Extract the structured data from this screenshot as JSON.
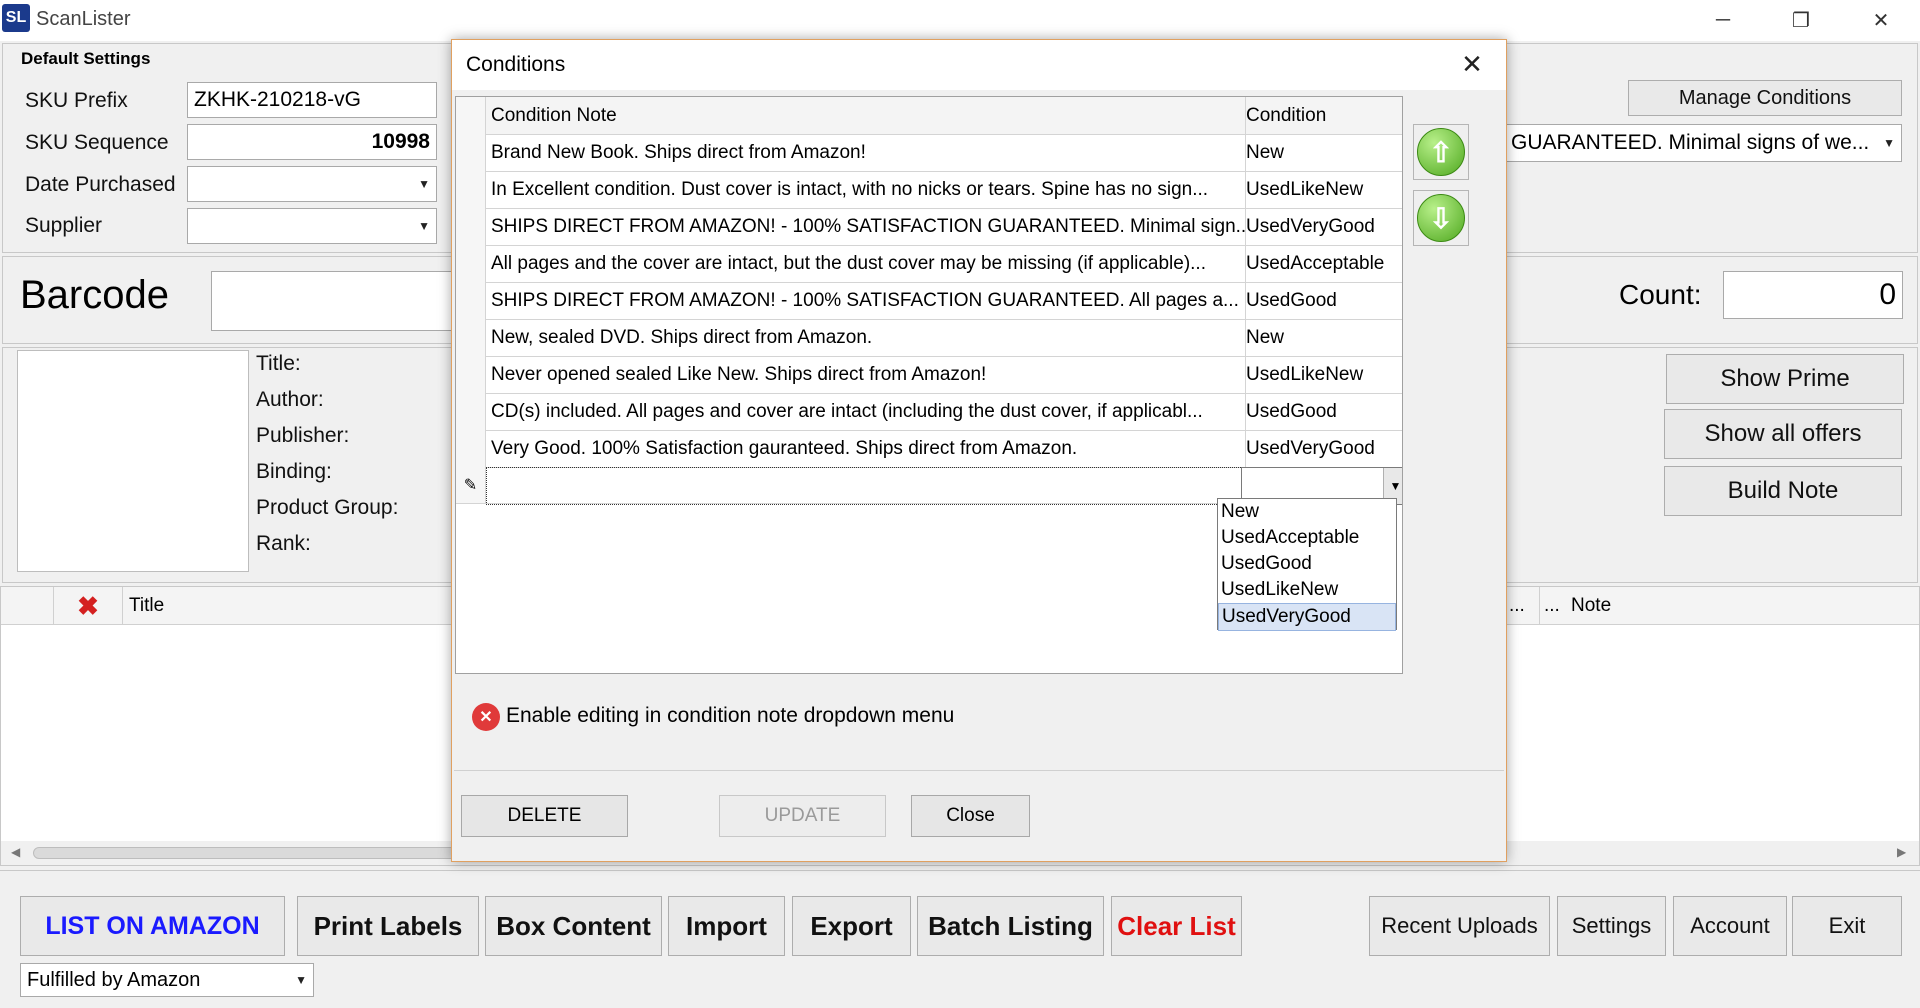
{
  "app": {
    "logo": "SL",
    "title": "ScanLister"
  },
  "window_controls": {
    "minimize": "─",
    "restore": "❐",
    "close": "✕"
  },
  "default_settings": {
    "heading": "Default Settings",
    "sku_prefix_label": "SKU Prefix",
    "sku_prefix_value": "ZKHK-210218-vG",
    "sku_sequence_label": "SKU Sequence",
    "sku_sequence_value": "10998",
    "date_purchased_label": "Date Purchased",
    "supplier_label": "Supplier"
  },
  "manage_conditions_label": "Manage Conditions",
  "condition_note_combo_value": "GUARANTEED. Minimal signs of we...",
  "barcode_label": "Barcode",
  "count_label": "Count:",
  "count_value": "0",
  "product_info": {
    "title_label": "Title:",
    "author_label": "Author:",
    "publisher_label": "Publisher:",
    "binding_label": "Binding:",
    "product_group_label": "Product Group:",
    "rank_label": "Rank:"
  },
  "side_buttons": {
    "show_prime": "Show Prime",
    "show_all_offers": "Show all offers",
    "build_note": "Build Note"
  },
  "list_grid": {
    "title_col": "Title",
    "ellipsis_left": "...",
    "ellipsis_right": "...",
    "note_col": "Note"
  },
  "bottom_toolbar": {
    "list_on_amazon": "LIST ON AMAZON",
    "print_labels": "Print Labels",
    "box_content": "Box Content",
    "import": "Import",
    "export": "Export",
    "batch_listing": "Batch Listing",
    "clear_list": "Clear List",
    "recent_uploads": "Recent Uploads",
    "settings": "Settings",
    "account": "Account",
    "exit": "Exit",
    "fulfillment_value": "Fulfilled by Amazon"
  },
  "dialog": {
    "title": "Conditions",
    "close_glyph": "✕",
    "columns": {
      "note": "Condition Note",
      "condition": "Condition"
    },
    "rows": [
      {
        "note": "Brand New Book.  Ships direct from Amazon!",
        "condition": "New"
      },
      {
        "note": "In Excellent condition. Dust cover is intact, with no nicks or tears. Spine has no sign...",
        "condition": "UsedLikeNew"
      },
      {
        "note": "SHIPS DIRECT FROM AMAZON! - 100% SATISFACTION GUARANTEED. Minimal sign...",
        "condition": "UsedVeryGood"
      },
      {
        "note": "All pages and the cover are intact, but the dust cover may be missing (if applicable)...",
        "condition": "UsedAcceptable"
      },
      {
        "note": "SHIPS DIRECT FROM AMAZON! - 100% SATISFACTION GUARANTEED. All pages a...",
        "condition": "UsedGood"
      },
      {
        "note": "New, sealed DVD. Ships direct from Amazon.",
        "condition": "New"
      },
      {
        "note": "Never opened sealed Like New. Ships direct from Amazon!",
        "condition": "UsedLikeNew"
      },
      {
        "note": "CD(s) included. All pages and cover are intact (including the dust cover, if applicabl...",
        "condition": "UsedGood"
      },
      {
        "note": "Very Good. 100% Satisfaction gauranteed. Ships direct from Amazon.",
        "condition": "UsedVeryGood"
      }
    ],
    "new_row_indicator": "✎",
    "dropdown_options": [
      "New",
      "UsedAcceptable",
      "UsedGood",
      "UsedLikeNew",
      "UsedVeryGood"
    ],
    "dropdown_selected": "UsedVeryGood",
    "enable_editing_label": "Enable editing in condition note dropdown menu",
    "enable_editing_icon": "✕",
    "up_glyph": "⇧",
    "down_glyph": "⇩",
    "delete_label": "DELETE",
    "update_label": "UPDATE",
    "close_label": "Close"
  },
  "colors": {
    "accent_blue": "#1a1aff",
    "clear_red": "#e01010",
    "dialog_border": "#e0a060"
  }
}
